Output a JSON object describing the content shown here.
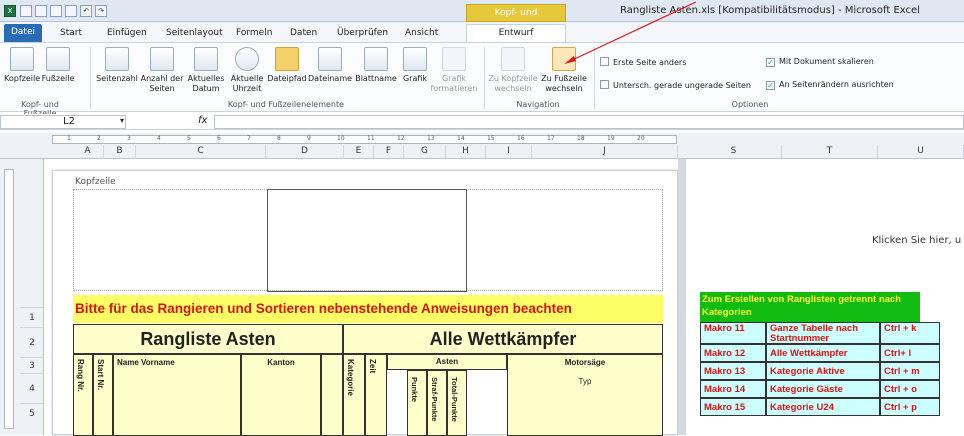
{
  "window": {
    "doc_title": "Rangliste Asten.xls [Kompatibilitätsmodus] - Microsoft Excel",
    "context_header": "Kopf- und Fußzeilentools"
  },
  "tabs": [
    "Datei",
    "Start",
    "Einfügen",
    "Seitenlayout",
    "Formeln",
    "Daten",
    "Überprüfen",
    "Ansicht",
    "Entwurf"
  ],
  "ribbon": {
    "kopf": "Kopfzeile",
    "fuss": "Fußzeile",
    "grp1": "Kopf- und Fußzeile",
    "seitenzahl": "Seitenzahl",
    "anzahl": "Anzahl der Seiten",
    "datum": "Aktuelles Datum",
    "uhrzeit": "Aktuelle Uhrzeit",
    "dateipfad": "Dateipfad",
    "dateiname": "Dateiname",
    "blattname": "Blattname",
    "grafik": "Grafik",
    "grafik_format": "Grafik formatieren",
    "grp2": "Kopf- und Fußzeilenelemente",
    "zu_kopf": "Zu Kopfzeile wechseln",
    "zu_fuss": "Zu Fußzeile wechseln",
    "grp3": "Navigation",
    "opt1": "Erste Seite anders",
    "opt2": "Untersch. gerade ungerade Seiten",
    "opt3": "Mit Dokument skalieren",
    "opt4": "An Seitenrändern ausrichten",
    "grp4": "Optionen"
  },
  "namebox": "L2",
  "fx": "fx",
  "columns": [
    "A",
    "B",
    "C",
    "D",
    "E",
    "F",
    "G",
    "H",
    "I",
    "J",
    "S",
    "T",
    "U"
  ],
  "ruler_ticks": [
    "1",
    "2",
    "3",
    "4",
    "5",
    "6",
    "7",
    "8",
    "9",
    "10",
    "11",
    "12",
    "13",
    "14",
    "15",
    "16",
    "17",
    "18",
    "19",
    "20"
  ],
  "rows": [
    "1",
    "2",
    "3",
    "4",
    "5"
  ],
  "page": {
    "header_label": "Kopfzeile",
    "instruction": "Bitte für das Rangieren und Sortieren nebenstehende Anweisungen beachten",
    "title_left": "Rangliste Asten",
    "title_right": "Alle Wettkämpfer",
    "h_rang": "Rang Nr.",
    "h_start": "Start Nr.",
    "h_name": "Name Vorname",
    "h_kanton": "Kanton",
    "h_kat": "Kategorie",
    "h_zeit": "Zeit",
    "h_asten": "Asten",
    "h_punkte": "Punkte",
    "h_straf": "Straf-Punkte",
    "h_total": "Total-Punkte",
    "h_motor": "Motorsäge",
    "h_typ": "Typ"
  },
  "page2": {
    "click_hint": "Klicken Sie hier, u",
    "macro_title": "Zum Erstellen von Ranglisten getrennt nach Kategorien",
    "macros": [
      {
        "name": "Makro 11",
        "desc": "Ganze Tabelle nach Startnummer",
        "key": "Ctrl + k"
      },
      {
        "name": "Makro 12",
        "desc": "Alle Wettkämpfer",
        "key": "Ctrl+ l"
      },
      {
        "name": "Makro 13",
        "desc": "Kategorie Aktive",
        "key": "Ctrl + m"
      },
      {
        "name": "Makro 14",
        "desc": "Kategorie Gäste",
        "key": "Ctrl + o"
      },
      {
        "name": "Makro 15",
        "desc": "Kategorie U24",
        "key": "Ctrl + p"
      }
    ]
  }
}
